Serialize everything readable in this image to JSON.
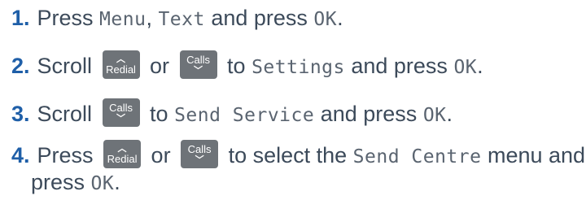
{
  "keys": {
    "redial": "Redial",
    "calls": "Calls",
    "up_icon": "chevron-up-icon",
    "down_icon": "chevron-down-icon"
  },
  "steps": [
    {
      "number": "1.",
      "t1": "Press ",
      "lcd1": "Menu",
      "t2": ", ",
      "lcd2": "Text",
      "t3": " and press ",
      "lcd3": "OK",
      "t4": "."
    },
    {
      "number": "2.",
      "t1": "Scroll ",
      "t2": " or ",
      "t3": " to ",
      "lcd1": "Settings",
      "t4": " and press ",
      "lcd2": "OK",
      "t5": "."
    },
    {
      "number": "3.",
      "t1": "Scroll ",
      "t2": " to ",
      "lcd1": "Send Service",
      "t3": " and press ",
      "lcd2": "OK",
      "t4": "."
    },
    {
      "number": "4.",
      "t1": "Press ",
      "t2": " or ",
      "t3": " to select the ",
      "lcd1": "Send Centre",
      "t4": " menu and",
      "t5": "press ",
      "lcd2": "OK",
      "t6": "."
    }
  ]
}
